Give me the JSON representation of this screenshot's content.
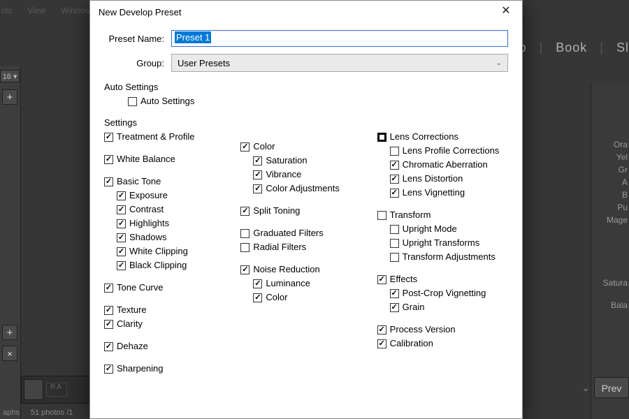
{
  "bg": {
    "menu": {
      "tools": "ols",
      "view": "View",
      "window": "Window"
    },
    "modules": {
      "map": "Map",
      "book": "Book",
      "slideshow": "Sl"
    },
    "left": {
      "badge16": "16 ▾",
      "plus": "+",
      "x": "×",
      "ra": "RA"
    },
    "right_labels": [
      "Ora",
      "Yel",
      "Gr",
      "A",
      "B",
      "Pu",
      "Mage"
    ],
    "right_lower": {
      "satura": "Satura",
      "bala": "Bala"
    },
    "status": {
      "aphs": "aphs",
      "count": "51 photos /1"
    },
    "prev": "Prev"
  },
  "dialog": {
    "title": "New Develop Preset",
    "labels": {
      "preset_name": "Preset Name:",
      "group": "Group:",
      "auto_settings": "Auto Settings",
      "settings": "Settings"
    },
    "preset_value": "Preset 1",
    "group_value": "User Presets",
    "auto": {
      "label": "Auto Settings",
      "checked": false
    },
    "col1": [
      {
        "label": "Treatment & Profile",
        "checked": true
      },
      {
        "gap": true
      },
      {
        "label": "White Balance",
        "checked": true
      },
      {
        "gap": true
      },
      {
        "label": "Basic Tone",
        "checked": true,
        "children": [
          {
            "label": "Exposure",
            "checked": true
          },
          {
            "label": "Contrast",
            "checked": true
          },
          {
            "label": "Highlights",
            "checked": true
          },
          {
            "label": "Shadows",
            "checked": true
          },
          {
            "label": "White Clipping",
            "checked": true
          },
          {
            "label": "Black Clipping",
            "checked": true
          }
        ]
      },
      {
        "gap": true
      },
      {
        "label": "Tone Curve",
        "checked": true
      },
      {
        "gap": true
      },
      {
        "label": "Texture",
        "checked": true
      },
      {
        "label": "Clarity",
        "checked": true
      },
      {
        "gap": true
      },
      {
        "label": "Dehaze",
        "checked": true
      },
      {
        "gap": true
      },
      {
        "label": "Sharpening",
        "checked": true
      }
    ],
    "col2": [
      {
        "label": "Color",
        "checked": true,
        "children": [
          {
            "label": "Saturation",
            "checked": true
          },
          {
            "label": "Vibrance",
            "checked": true
          },
          {
            "label": "Color Adjustments",
            "checked": true
          }
        ]
      },
      {
        "gap": true
      },
      {
        "label": "Split Toning",
        "checked": true
      },
      {
        "gap": true
      },
      {
        "label": "Graduated Filters",
        "checked": false
      },
      {
        "label": "Radial Filters",
        "checked": false
      },
      {
        "gap": true
      },
      {
        "label": "Noise Reduction",
        "checked": true,
        "children": [
          {
            "label": "Luminance",
            "checked": true
          },
          {
            "label": "Color",
            "checked": true
          }
        ]
      }
    ],
    "col3": [
      {
        "label": "Lens Corrections",
        "mixed": true,
        "children": [
          {
            "label": "Lens Profile Corrections",
            "checked": false
          },
          {
            "label": "Chromatic Aberration",
            "checked": true
          },
          {
            "label": "Lens Distortion",
            "checked": true
          },
          {
            "label": "Lens Vignetting",
            "checked": true
          }
        ]
      },
      {
        "gap": true
      },
      {
        "label": "Transform",
        "checked": false,
        "children": [
          {
            "label": "Upright Mode",
            "checked": false
          },
          {
            "label": "Upright Transforms",
            "checked": false
          },
          {
            "label": "Transform Adjustments",
            "checked": false
          }
        ]
      },
      {
        "gap": true
      },
      {
        "label": "Effects",
        "checked": true,
        "children": [
          {
            "label": "Post-Crop Vignetting",
            "checked": true
          },
          {
            "label": "Grain",
            "checked": true
          }
        ]
      },
      {
        "gap": true
      },
      {
        "label": "Process Version",
        "checked": true
      },
      {
        "label": "Calibration",
        "checked": true
      }
    ]
  }
}
